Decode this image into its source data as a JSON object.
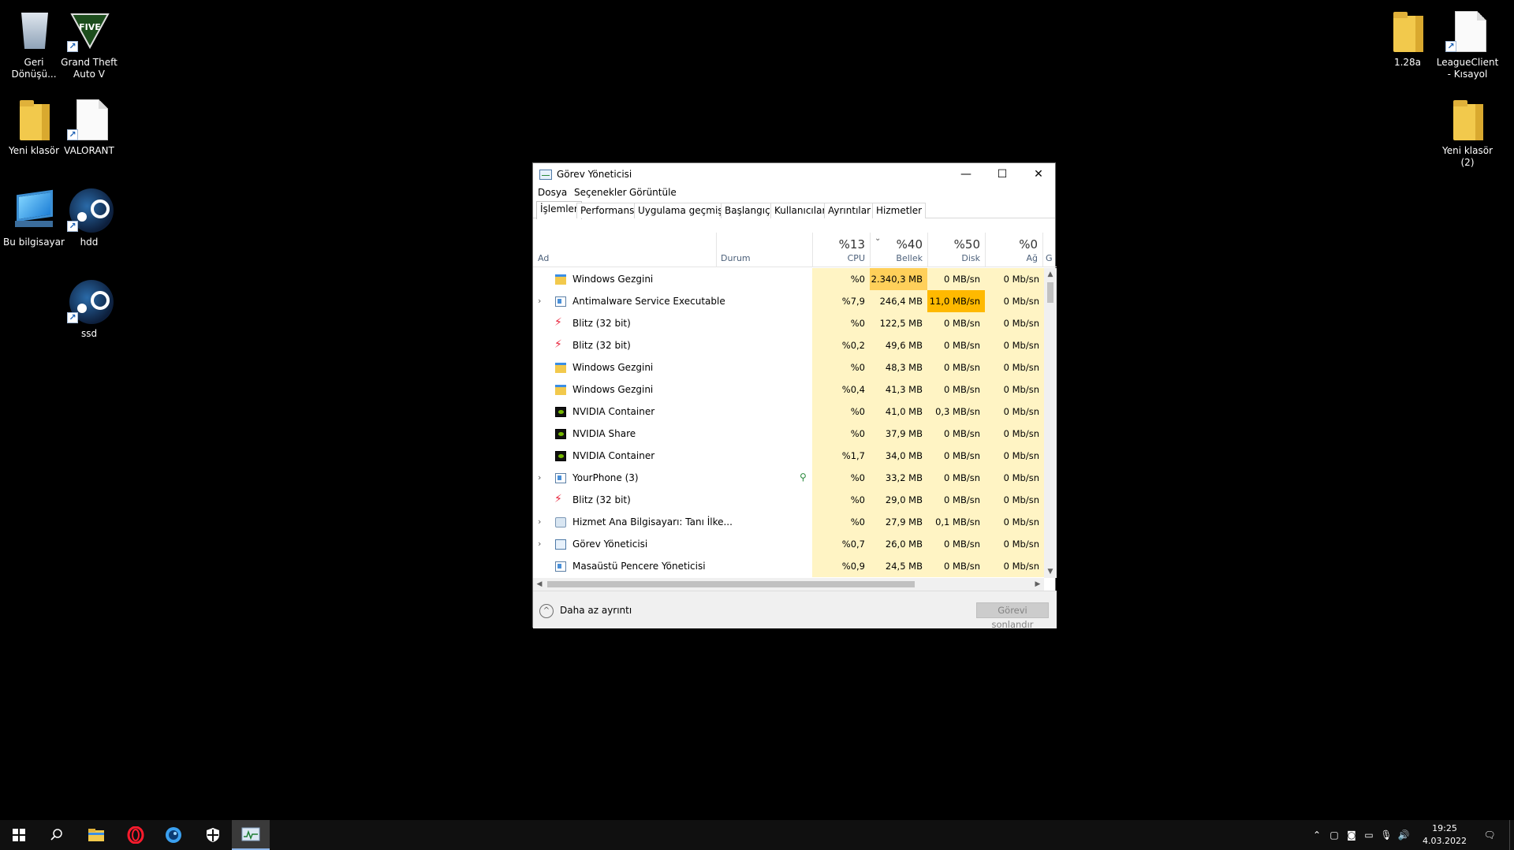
{
  "desktop": {
    "icons_left": [
      {
        "label": "Geri\nDönüşü..."
      },
      {
        "label": "Grand Theft\nAuto V"
      },
      {
        "label": "Yeni klasör"
      },
      {
        "label": "VALORANT"
      },
      {
        "label": "Bu bilgisayar"
      },
      {
        "label": "hdd"
      },
      {
        "label": "ssd"
      }
    ],
    "icons_right": [
      {
        "label": "1.28a"
      },
      {
        "label": "LeagueClient\n- Kısayol"
      },
      {
        "label": "Yeni klasör\n(2)"
      }
    ]
  },
  "taskmanager": {
    "title": "Görev Yöneticisi",
    "window_buttons": {
      "minimize": "—",
      "maximize": "☐",
      "close": "✕"
    },
    "menu": [
      "Dosya",
      "Seçenekler",
      "Görüntüle"
    ],
    "tabs": [
      "İşlemler",
      "Performans",
      "Uygulama geçmişi",
      "Başlangıç",
      "Kullanıcılar",
      "Ayrıntılar",
      "Hizmetler"
    ],
    "active_tab": "İşlemler",
    "columns": {
      "name": "Ad",
      "status": "Durum",
      "cpu": {
        "pct": "%13",
        "label": "CPU"
      },
      "memory": {
        "pct": "%40",
        "label": "Bellek"
      },
      "disk": {
        "pct": "%50",
        "label": "Disk"
      },
      "network": {
        "pct": "%0",
        "label": "Ağ"
      },
      "gpu_partial": "G"
    },
    "rows": [
      {
        "name": "Windows Gezgini",
        "icon": "explorer-icon",
        "expandable": false,
        "cpu": "%0",
        "mem": "2.340,3 MB",
        "disk": "0 MB/sn",
        "net": "0 Mb/sn"
      },
      {
        "name": "Antimalware Service Executable",
        "icon": "service-window-icon",
        "expandable": true,
        "cpu": "%7,9",
        "mem": "246,4 MB",
        "disk": "11,0 MB/sn",
        "net": "0 Mb/sn"
      },
      {
        "name": "Blitz (32 bit)",
        "icon": "blitz-icon",
        "expandable": false,
        "cpu": "%0",
        "mem": "122,5 MB",
        "disk": "0 MB/sn",
        "net": "0 Mb/sn"
      },
      {
        "name": "Blitz (32 bit)",
        "icon": "blitz-icon",
        "expandable": false,
        "cpu": "%0,2",
        "mem": "49,6 MB",
        "disk": "0 MB/sn",
        "net": "0 Mb/sn"
      },
      {
        "name": "Windows Gezgini",
        "icon": "explorer-icon",
        "expandable": false,
        "cpu": "%0",
        "mem": "48,3 MB",
        "disk": "0 MB/sn",
        "net": "0 Mb/sn"
      },
      {
        "name": "Windows Gezgini",
        "icon": "explorer-icon",
        "expandable": false,
        "cpu": "%0,4",
        "mem": "41,3 MB",
        "disk": "0 MB/sn",
        "net": "0 Mb/sn"
      },
      {
        "name": "NVIDIA Container",
        "icon": "nvidia-icon",
        "expandable": false,
        "cpu": "%0",
        "mem": "41,0 MB",
        "disk": "0,3 MB/sn",
        "net": "0 Mb/sn"
      },
      {
        "name": "NVIDIA Share",
        "icon": "nvidia-icon",
        "expandable": false,
        "cpu": "%0",
        "mem": "37,9 MB",
        "disk": "0 MB/sn",
        "net": "0 Mb/sn"
      },
      {
        "name": "NVIDIA Container",
        "icon": "nvidia-icon",
        "expandable": false,
        "cpu": "%1,7",
        "mem": "34,0 MB",
        "disk": "0 MB/sn",
        "net": "0 Mb/sn"
      },
      {
        "name": "YourPhone (3)",
        "icon": "service-window-icon",
        "expandable": true,
        "leaf": true,
        "cpu": "%0",
        "mem": "33,2 MB",
        "disk": "0 MB/sn",
        "net": "0 Mb/sn"
      },
      {
        "name": "Blitz (32 bit)",
        "icon": "blitz-icon",
        "expandable": false,
        "cpu": "%0",
        "mem": "29,0 MB",
        "disk": "0 MB/sn",
        "net": "0 Mb/sn"
      },
      {
        "name": "Hizmet Ana Bilgisayarı: Tanı İlke...",
        "icon": "gear-icon",
        "expandable": true,
        "cpu": "%0",
        "mem": "27,9 MB",
        "disk": "0,1 MB/sn",
        "net": "0 Mb/sn"
      },
      {
        "name": "Görev Yöneticisi",
        "icon": "task-manager-icon",
        "expandable": true,
        "cpu": "%0,7",
        "mem": "26,0 MB",
        "disk": "0 MB/sn",
        "net": "0 Mb/sn"
      },
      {
        "name": "Masaüstü Pencere Yöneticisi",
        "icon": "service-window-icon",
        "expandable": false,
        "cpu": "%0,9",
        "mem": "24,5 MB",
        "disk": "0 MB/sn",
        "net": "0 Mb/sn"
      }
    ],
    "footer": {
      "less_details": "Daha az ayrıntı",
      "end_task": "Görevi sonlandır"
    },
    "colors": {
      "cpu_bg": "#fff4c4",
      "mem_bg": "#fff4c4",
      "mem_hot": "#ffd05a",
      "disk_hot": "#ffb900",
      "disk_bg": "#fff4c4",
      "net_bg": "#fff4c4"
    }
  },
  "taskbar": {
    "start": "⊞",
    "search": "⌕",
    "apps": [
      "file-explorer-icon",
      "opera-icon",
      "blue-app-icon",
      "security-icon",
      "task-manager-icon"
    ],
    "tray": {
      "chevron": "^",
      "time": "19:25",
      "date": "4.03.2022"
    }
  }
}
